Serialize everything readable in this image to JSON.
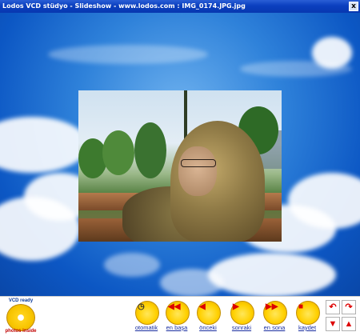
{
  "window": {
    "title": "Lodos VCD stüdyo - Slideshow - www.lodos.com : IMG_0174.JPG.jpg",
    "close_label": "x"
  },
  "badge": {
    "top_text": "VCD ready",
    "bottom_text": "photos inside"
  },
  "toolbar": {
    "buttons": [
      {
        "label": "otomatik",
        "icon": "clock-icon"
      },
      {
        "label": "en başa",
        "icon": "rewind-to-start-icon"
      },
      {
        "label": "önceki",
        "icon": "previous-icon"
      },
      {
        "label": "sonraki",
        "icon": "next-icon"
      },
      {
        "label": "en sona",
        "icon": "forward-to-end-icon"
      },
      {
        "label": "kaydet",
        "icon": "save-icon"
      }
    ],
    "rotate_left": "↶",
    "rotate_right": "↷",
    "move_up": "▲",
    "move_down": "▼"
  },
  "colors": {
    "titlebar": "#0a3fbf",
    "sky": "#2f82da",
    "button_disc": "#ffd000",
    "label_link": "#1a2fa0"
  }
}
